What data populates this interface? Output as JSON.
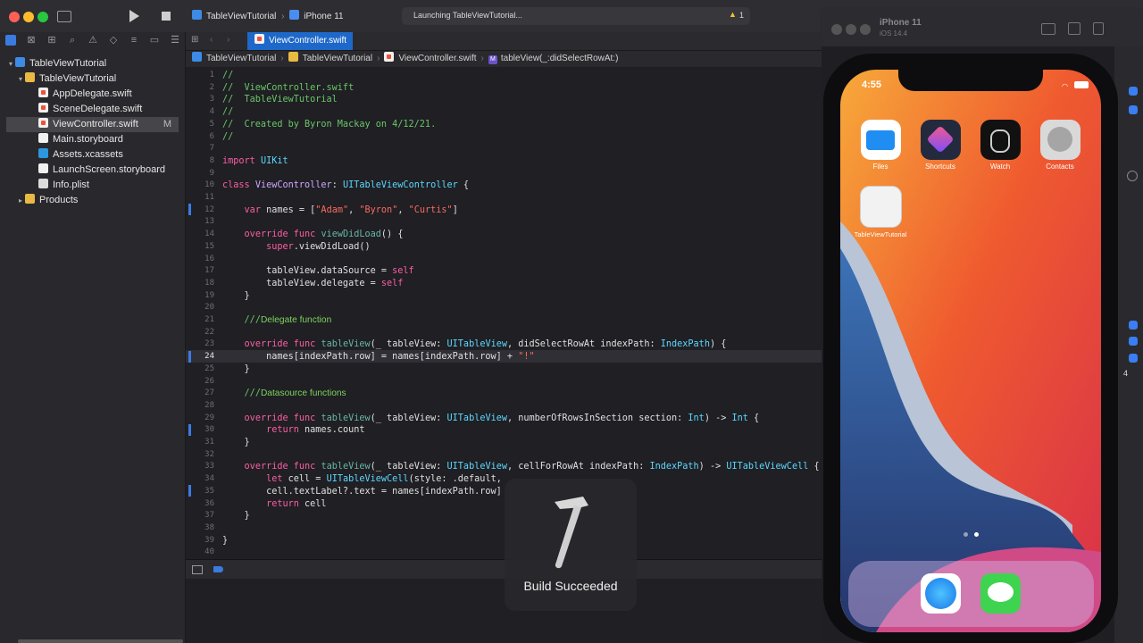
{
  "toolbar": {
    "scheme": "TableViewTutorial",
    "device": "iPhone 11",
    "status": "Launching TableViewTutorial...",
    "warning_count": "1"
  },
  "navigator": {
    "items": [
      {
        "label": "TableViewTutorial",
        "icon": "project-icon",
        "level": 0,
        "expanded": true
      },
      {
        "label": "TableViewTutorial",
        "icon": "folder-icon",
        "level": 1,
        "expanded": true
      },
      {
        "label": "AppDelegate.swift",
        "icon": "swift-file-icon",
        "level": 2
      },
      {
        "label": "SceneDelegate.swift",
        "icon": "swift-file-icon",
        "level": 2
      },
      {
        "label": "ViewController.swift",
        "icon": "swift-file-icon",
        "level": 2,
        "selected": true,
        "badge": "M"
      },
      {
        "label": "Main.storyboard",
        "icon": "storyboard-icon",
        "level": 2
      },
      {
        "label": "Assets.xcassets",
        "icon": "assets-icon",
        "level": 2
      },
      {
        "label": "LaunchScreen.storyboard",
        "icon": "storyboard-icon",
        "level": 2
      },
      {
        "label": "Info.plist",
        "icon": "plist-icon",
        "level": 2
      },
      {
        "label": "Products",
        "icon": "folder-icon",
        "level": 1,
        "expanded": false
      }
    ]
  },
  "editor": {
    "tab": "ViewController.swift",
    "breadcrumb": [
      "TableViewTutorial",
      "TableViewTutorial",
      "ViewController.swift",
      "tableView(_:didSelectRowAt:)"
    ],
    "current_line": "24",
    "lines": [
      "//",
      "//  ViewController.swift",
      "//  TableViewTutorial",
      "//",
      "//  Created by Byron Mackay on 4/12/21.",
      "//",
      "",
      "import UIKit",
      "",
      "class ViewController: UITableViewController {",
      "",
      "    var names = [\"Adam\", \"Byron\", \"Curtis\"]",
      "",
      "    override func viewDidLoad() {",
      "        super.viewDidLoad()",
      "",
      "        tableView.dataSource = self",
      "        tableView.delegate = self",
      "    }",
      "",
      "    ///Delegate function",
      "",
      "    override func tableView(_ tableView: UITableView, didSelectRowAt indexPath: IndexPath) {",
      "        names[indexPath.row] = names[indexPath.row] + \"!\"",
      "    }",
      "",
      "    ///Datasource functions",
      "",
      "    override func tableView(_ tableView: UITableView, numberOfRowsInSection section: Int) -> Int {",
      "        return names.count",
      "    }",
      "",
      "    override func tableView(_ tableView: UITableView, cellForRowAt indexPath: IndexPath) -> UITableViewCell {",
      "        let cell = UITableViewCell(style: .default,",
      "        cell.textLabel?.text = names[indexPath.row]",
      "        return cell",
      "    }",
      "",
      "}",
      ""
    ]
  },
  "simulator": {
    "device": "iPhone 11",
    "os": "iOS 14.4",
    "time": "4:55",
    "apps": [
      {
        "label": "Files",
        "icon": "files-icon",
        "color": "#1f8df2"
      },
      {
        "label": "Shortcuts",
        "icon": "shortcuts-icon",
        "color": "#e0417f"
      },
      {
        "label": "Watch",
        "icon": "watch-icon",
        "color": "#111111"
      },
      {
        "label": "Contacts",
        "icon": "contacts-icon",
        "color": "#cfcfcf"
      },
      {
        "label": "TableViewTutorial",
        "icon": "app-placeholder-icon",
        "color": "#f2f2f2"
      }
    ],
    "dock": [
      {
        "label": "Safari",
        "icon": "safari-icon"
      },
      {
        "label": "Messages",
        "icon": "messages-icon"
      }
    ]
  },
  "right_panel": {
    "stepper_value": "4"
  },
  "build_toast": {
    "label": "Build Succeeded"
  }
}
